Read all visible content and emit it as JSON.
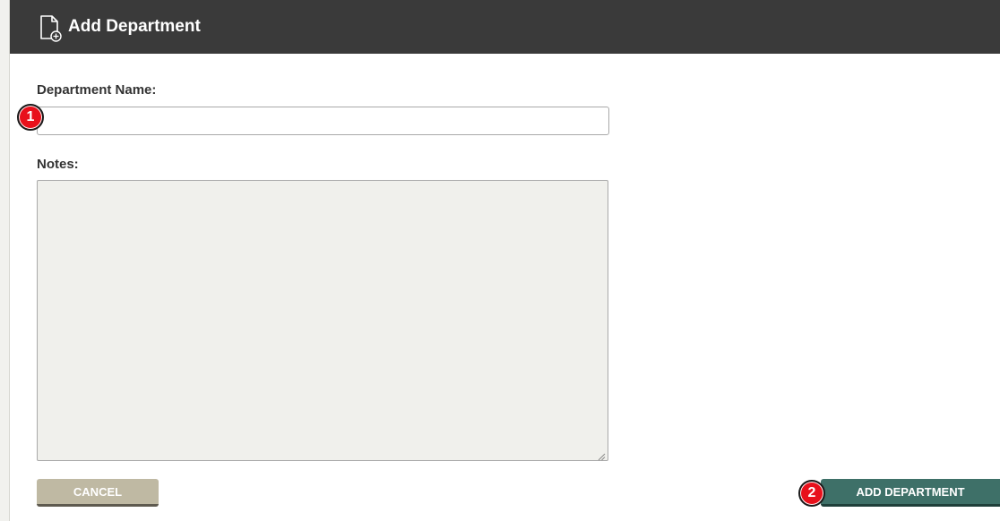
{
  "dialog": {
    "title": "Add Department",
    "header_icon": "new-document-icon"
  },
  "form": {
    "department_name": {
      "label": "Department Name:",
      "value": "",
      "placeholder": ""
    },
    "notes": {
      "label": "Notes:",
      "value": "",
      "placeholder": ""
    }
  },
  "buttons": {
    "cancel_label": "CANCEL",
    "add_label": "ADD DEPARTMENT"
  },
  "markers": [
    {
      "label": "1"
    },
    {
      "label": "2"
    }
  ],
  "colors": {
    "header_bg": "#3a3a3a",
    "cancel_bg": "#bfb9a3",
    "add_bg": "#3e7068",
    "marker_red": "#e8101b",
    "notes_bg": "#f0f0ec"
  }
}
